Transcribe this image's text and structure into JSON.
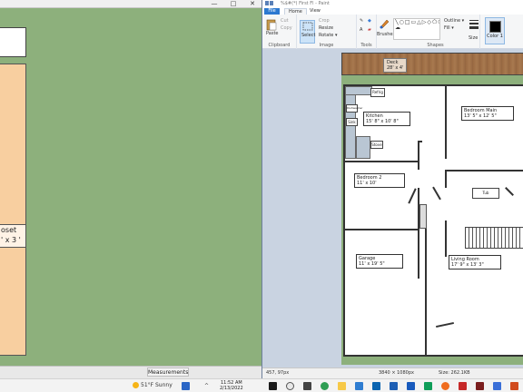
{
  "left_app": {
    "closet_label_line1": "oset",
    "closet_label_line2": "' x 3 '",
    "measurements_tab": "Measurements",
    "window_controls": [
      "—",
      "□",
      "✕"
    ]
  },
  "paint": {
    "title": "%$#(*( First Fl - Paint",
    "menu_tabs": [
      "File",
      "Home",
      "View"
    ],
    "ribbon": {
      "clipboard": {
        "paste": "Paste",
        "cut": "Cut",
        "copy": "Copy",
        "label": "Clipboard"
      },
      "image": {
        "select": "Select",
        "crop": "Crop",
        "resize": "Resize",
        "rotate": "Rotate ▾",
        "label": "Image"
      },
      "tools": {
        "label": "Tools"
      },
      "brushes": "Brushes",
      "shapes": {
        "outline": "Outline ▾",
        "fill": "Fill ▾",
        "label": "Shapes"
      },
      "size": "Size",
      "color1": "Color 1"
    },
    "status": {
      "cursor": "457, 97px",
      "dimensions": "3840 × 1080px",
      "size": "Size: 262.1KB"
    }
  },
  "floor_plan": {
    "deck": {
      "name": "Deck",
      "size": "28' x 4'"
    },
    "rooms": [
      {
        "name": "Kitchen",
        "size": "15' 8\" x 10' 8\""
      },
      {
        "name": "Bedroom Main",
        "size": "13' 5\" x 12' 5\""
      },
      {
        "name": "Bedroom 2",
        "size": "11' x 10'"
      },
      {
        "name": "Garage",
        "size": "11' x 19' 5\""
      },
      {
        "name": "Living Room",
        "size": "17' 9\" x 13' 3\""
      }
    ],
    "appliances": [
      "Refrig",
      "Dishwasher",
      "Sink",
      "Stove"
    ],
    "tub_label": "Tub"
  },
  "taskbar": {
    "weather": "51°F  Sunny",
    "time": "11:52 AM",
    "date": "2/13/2022"
  }
}
